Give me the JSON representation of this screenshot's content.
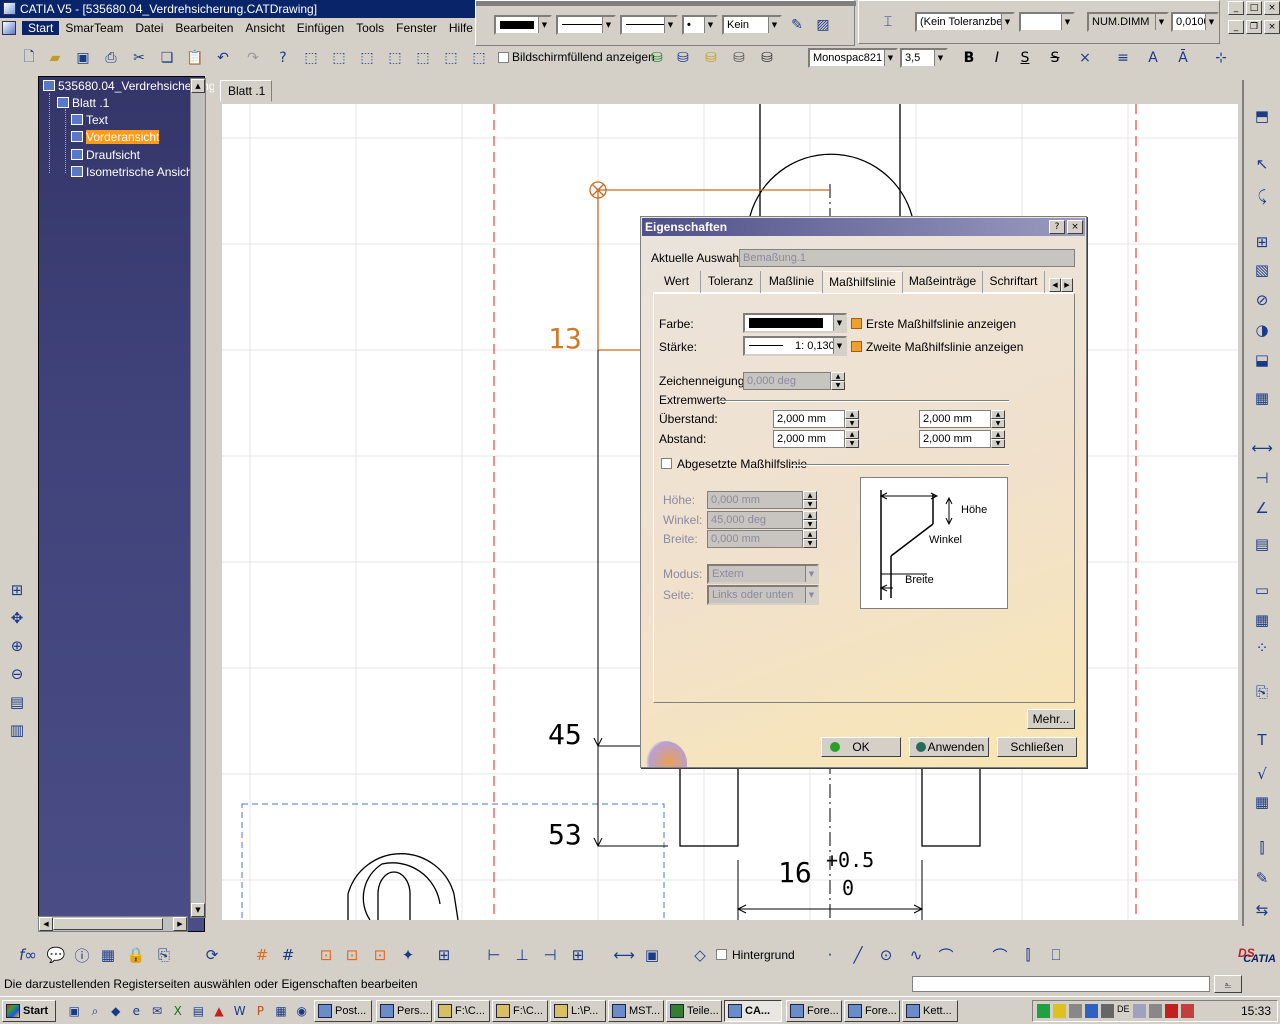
{
  "window": {
    "title": "CATIA V5 - [535680.04_Verdrehsicherung.CATDrawing]"
  },
  "menu": [
    "Start",
    "SmarTeam",
    "Datei",
    "Bearbeiten",
    "Ansicht",
    "Einfügen",
    "Tools",
    "Fenster",
    "Hilfe"
  ],
  "toolbar": {
    "line_pattern_label": "Kein",
    "fullscreen_label": "Bildschirmfüllend anzeigen",
    "font_name": "Monospac821",
    "font_size": "3,5",
    "tolerance_combo": "(Kein Toleranzber",
    "num_combo": "NUM.DIMM",
    "precision_combo": "0,0100",
    "bold": "B",
    "italic": "I",
    "underline": "S",
    "strike": "S"
  },
  "tree": {
    "root": "535680.04_Verdrehsicherung",
    "sheet": "Blatt .1",
    "items": [
      "Text",
      "Vorderansicht",
      "Draufsicht",
      "Isometrische Ansicht"
    ]
  },
  "sheet_tab": "Blatt .1",
  "drawing": {
    "dim_13": "13",
    "dim_45": "45",
    "dim_53": "53",
    "dim_16": "16",
    "tol_upper": "+0.5",
    "tol_lower": "0"
  },
  "dialog": {
    "title": "Eigenschaften",
    "current_selection_label": "Aktuelle Auswahl:",
    "current_selection_value": "Bemaßung.1",
    "tabs": [
      "Wert",
      "Toleranz",
      "Maßlinie",
      "Maßhilfslinie",
      "Maßeinträge",
      "Schriftart"
    ],
    "farbe_label": "Farbe:",
    "staerke_label": "Stärke:",
    "staerke_value": "1: 0,130",
    "erste_label": "Erste Maßhilfslinie anzeigen",
    "zweite_label": "Zweite Maßhilfslinie anzeigen",
    "zeichenneigung_label": "Zeichenneigung:",
    "zeichenneigung_value": "0,000 deg",
    "extremwerte_label": "Extremwerte",
    "ueberstand_label": "Überstand:",
    "ueberstand_1": "2,000 mm",
    "ueberstand_2": "2,000 mm",
    "abstand_label": "Abstand:",
    "abstand_1": "2,000 mm",
    "abstand_2": "2,000 mm",
    "abgesetzte_label": "Abgesetzte Maßhilfslinie",
    "hoehe_label": "Höhe:",
    "hoehe_value": "0,000 mm",
    "winkel_label": "Winkel:",
    "winkel_value": "45,000 deg",
    "breite_label": "Breite:",
    "breite_value": "0,000 mm",
    "modus_label": "Modus:",
    "modus_value": "Extern",
    "seite_label": "Seite:",
    "seite_value": "Links oder unten",
    "diagram_hoehe": "Höhe",
    "diagram_winkel": "Winkel",
    "diagram_breite": "Breite",
    "mehr": "Mehr...",
    "ok": "OK",
    "anwenden": "Anwenden",
    "schliessen": "Schließen"
  },
  "bottom_toolbar": {
    "hintergrund": "Hintergrund"
  },
  "status": "Die darzustellenden Registerseiten auswählen oder Eigenschaften bearbeiten",
  "taskbar": {
    "start": "Start",
    "tasks": [
      "Post...",
      "Pers...",
      "F:\\C...",
      "F:\\C...",
      "L:\\P...",
      "MST...",
      "Teile...",
      "CA...",
      "Fore...",
      "Fore...",
      "Kett..."
    ],
    "clock": "15:33"
  }
}
